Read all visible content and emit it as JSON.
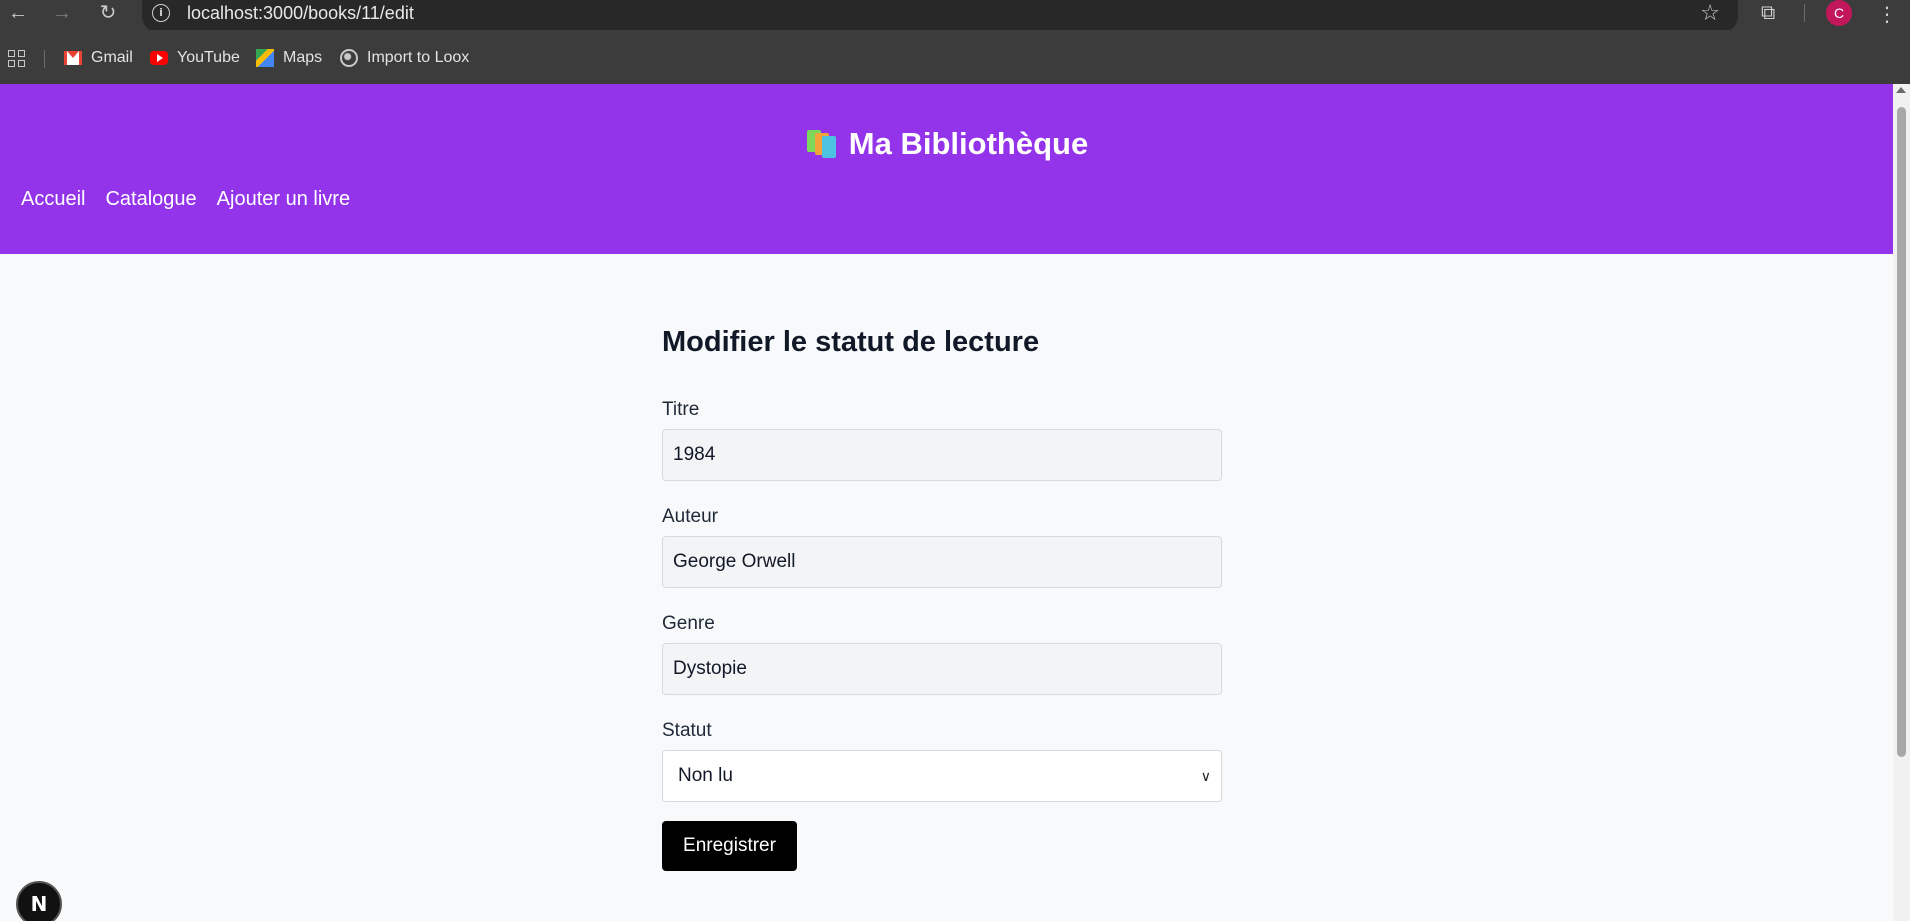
{
  "browser": {
    "url": "localhost:3000/books/11/edit",
    "profile_initial": "C",
    "bookmarks": [
      {
        "label": "Gmail",
        "icon": "gmail-icon"
      },
      {
        "label": "YouTube",
        "icon": "youtube-icon"
      },
      {
        "label": "Maps",
        "icon": "maps-icon"
      },
      {
        "label": "Import to Loox",
        "icon": "globe-icon"
      }
    ]
  },
  "header": {
    "title": "Ma Bibliothèque",
    "icon": "books-icon",
    "nav": [
      "Accueil",
      "Catalogue",
      "Ajouter un livre"
    ]
  },
  "form": {
    "title": "Modifier le statut de lecture",
    "fields": [
      {
        "label": "Titre",
        "value": "1984"
      },
      {
        "label": "Auteur",
        "value": "George Orwell"
      },
      {
        "label": "Genre",
        "value": "Dystopie"
      }
    ],
    "status": {
      "label": "Statut",
      "value": "Non lu"
    },
    "submit_label": "Enregistrer"
  },
  "badge": "N",
  "colors": {
    "header_bg": "#9333ea",
    "page_bg": "#f8f9fb",
    "button_bg": "#000000"
  }
}
